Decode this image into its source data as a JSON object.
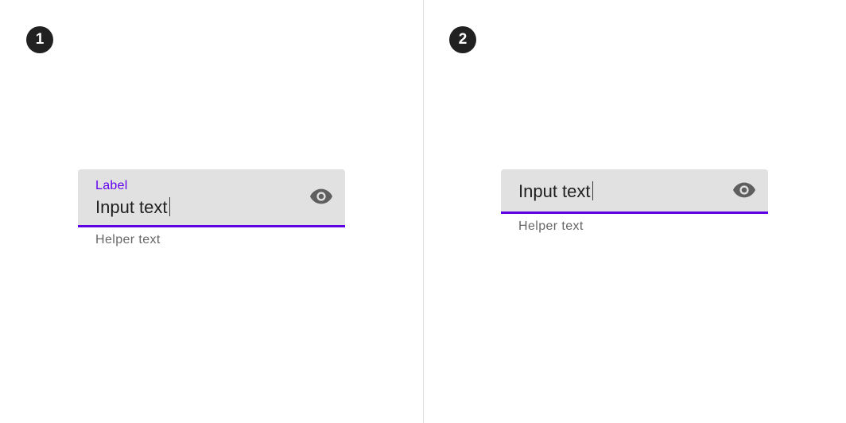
{
  "panels": [
    {
      "number": "1",
      "field": {
        "label": "Label",
        "value": "Input text",
        "trailing_icon": "eye-icon"
      },
      "helper_text": "Helper text"
    },
    {
      "number": "2",
      "field": {
        "value": "Input text",
        "trailing_icon": "eye-icon"
      },
      "helper_text": "Helper text"
    }
  ],
  "colors": {
    "accent": "#6200ee",
    "field_background": "#e1e1e1",
    "badge": "#212121",
    "helper": "#666666"
  }
}
